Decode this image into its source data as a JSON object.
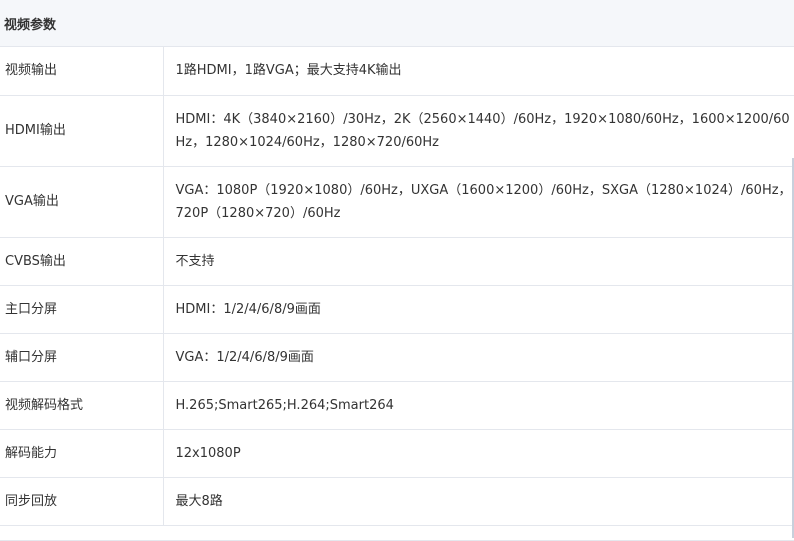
{
  "section": {
    "title": "视频参数"
  },
  "rows": [
    {
      "label": "视频输出",
      "value": "1路HDMI，1路VGA；最大支持4K输出"
    },
    {
      "label": "HDMI输出",
      "value": "HDMI：4K（3840×2160）/30Hz，2K（2560×1440）/60Hz，1920×1080/60Hz，1600×1200/60Hz，1280×1024/60Hz，1280×720/60Hz"
    },
    {
      "label": "VGA输出",
      "value": "VGA：1080P（1920×1080）/60Hz，UXGA（1600×1200）/60Hz，SXGA（1280×1024）/60Hz，720P（1280×720）/60Hz"
    },
    {
      "label": "CVBS输出",
      "value": "不支持"
    },
    {
      "label": "主口分屏",
      "value": "HDMI：1/2/4/6/8/9画面"
    },
    {
      "label": "辅口分屏",
      "value": "VGA：1/2/4/6/8/9画面"
    },
    {
      "label": "视频解码格式",
      "value": "H.265;Smart265;H.264;Smart264"
    },
    {
      "label": "解码能力",
      "value": "12x1080P"
    },
    {
      "label": "同步回放",
      "value": "最大8路"
    }
  ]
}
